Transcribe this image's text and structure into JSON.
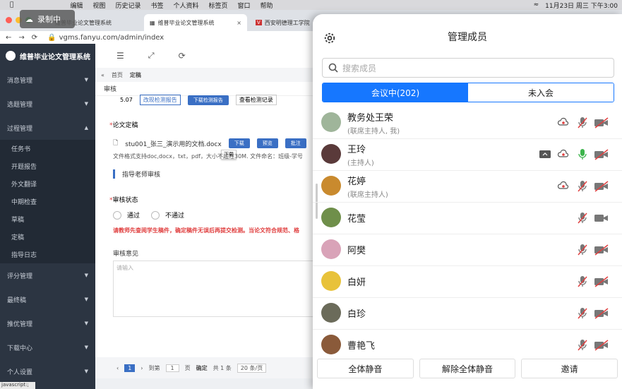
{
  "menubar": {
    "items": [
      "编辑",
      "视图",
      "历史记录",
      "书签",
      "个人资料",
      "标签页",
      "窗口",
      "帮助"
    ],
    "datetime": "11月23日 周三 下午3:00"
  },
  "recording_badge": "录制中",
  "tabs": [
    {
      "label": "维普毕业论文管理系统"
    },
    {
      "label": "维普毕业论文管理系统"
    },
    {
      "label": "西安明德理工学院"
    }
  ],
  "address": "vgms.fanyu.com/admin/index",
  "sidebar": {
    "app_title": "维普毕业论文管理系统",
    "sections": [
      {
        "label": "消息管理"
      },
      {
        "label": "选题管理"
      },
      {
        "label": "过程管理"
      }
    ],
    "process_items": [
      "任务书",
      "开题报告",
      "外文翻译",
      "中期检查",
      "草稿",
      "定稿",
      "指导日志"
    ],
    "bottom_sections": [
      "评分管理",
      "最终稿",
      "推优管理",
      "下载中心",
      "个人设置"
    ]
  },
  "breadcrumb": {
    "home": "首页",
    "current": "定稿"
  },
  "dialog": {
    "title": "审核",
    "top_value": "5.07",
    "top_btn1": "改现检测报告",
    "top_btn2": "下载检测报告",
    "top_btn3": "查看检测记录",
    "section_label": "论文定稿",
    "file_name": "stu001_张三_演示用的文档.docx",
    "download": "下载",
    "preview": "预览",
    "annotate": "批注",
    "tooltip": "下载",
    "format_hint": "文件格式支持doc,docx，txt，pdf，大小不超过30M. 文件命名：班级-学号",
    "advisor_review": "指导老师审核",
    "review_status": "审核状态",
    "pass": "通过",
    "fail": "不通过",
    "warning": "请教师先查阅学生稿件，确定稿件无误后再提交检测。当论文符合规范、格",
    "opinion": "审核意见",
    "opinion_placeholder": "请输入"
  },
  "pager": {
    "page": "1",
    "goto": "到第",
    "page_input": "1",
    "page_unit": "页",
    "confirm": "确定",
    "total": "共 1 条",
    "page_size": "20 条/页"
  },
  "status_url": "javascript:;",
  "panel": {
    "title": "管理成员",
    "search_placeholder": "搜索成员",
    "tab_in_meeting": "会议中(202)",
    "tab_not_joined": "未入会",
    "members": [
      {
        "name": "教务处王荣",
        "role": "(联席主持人, 我)"
      },
      {
        "name": "王玲",
        "role": "(主持人)"
      },
      {
        "name": "花婷",
        "role": "(联席主持人)"
      },
      {
        "name": "花莹",
        "role": ""
      },
      {
        "name": "阿樊",
        "role": ""
      },
      {
        "name": "白妍",
        "role": ""
      },
      {
        "name": "白珍",
        "role": ""
      },
      {
        "name": "曹艳飞",
        "role": ""
      }
    ],
    "footer": {
      "mute_all": "全体静音",
      "unmute_all": "解除全体静音",
      "invite": "邀请"
    }
  },
  "colors": {
    "accent": "#1677ff",
    "sidebar": "#2c3542",
    "muted_red": "#e04040"
  }
}
